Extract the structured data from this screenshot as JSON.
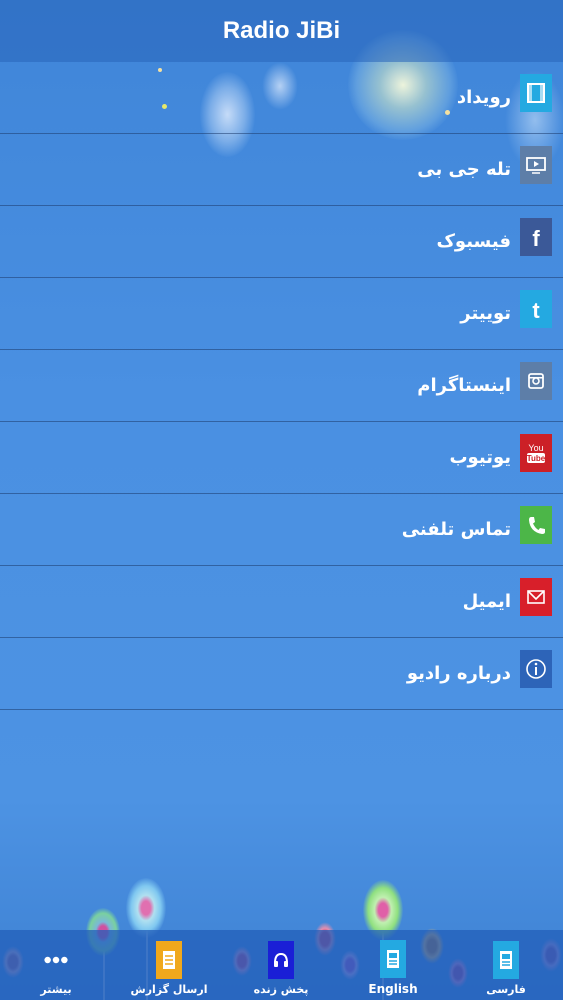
{
  "header": {
    "title": "Radio JiBi"
  },
  "menu": {
    "items": [
      {
        "label": "رویداد",
        "icon": "film-icon",
        "color": "#24a9e1"
      },
      {
        "label": "تله جی بی",
        "icon": "tv-icon",
        "color": "#5d7ea8"
      },
      {
        "label": "فیسبوک",
        "icon": "facebook-icon",
        "color": "#3b5998"
      },
      {
        "label": "توییتر",
        "icon": "twitter-icon",
        "color": "#24a9e1"
      },
      {
        "label": "اینستاگرام",
        "icon": "instagram-icon",
        "color": "#5d7ea8"
      },
      {
        "label": "یوتیوب",
        "icon": "youtube-icon",
        "color": "#cc2027"
      },
      {
        "label": "تماس تلفنی",
        "icon": "phone-icon",
        "color": "#4cb648"
      },
      {
        "label": "ایمیل",
        "icon": "mail-icon",
        "color": "#d81f2a"
      },
      {
        "label": "درباره رادیو",
        "icon": "info-icon",
        "color": "#2d64b8"
      }
    ]
  },
  "tabbar": {
    "items": [
      {
        "label": "بیشتر",
        "icon": "more-dots-icon"
      },
      {
        "label": "ارسال گزارش",
        "icon": "report-icon",
        "color": "#f0a81c"
      },
      {
        "label": "پخش زنده",
        "icon": "headphones-icon",
        "color": "#1a1fd6"
      },
      {
        "label": "English",
        "icon": "english-news-icon",
        "color": "#24a9e1"
      },
      {
        "label": "فارسی",
        "icon": "farsi-news-icon",
        "color": "#24a9e1"
      }
    ]
  }
}
